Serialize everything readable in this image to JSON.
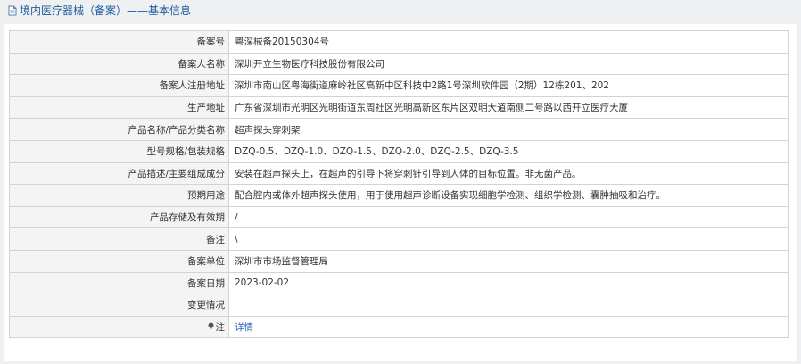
{
  "header": {
    "title": "境内医疗器械（备案）——基本信息"
  },
  "rows": [
    {
      "label": "备案号",
      "value": "粤深械备20150304号"
    },
    {
      "label": "备案人名称",
      "value": "深圳开立生物医疗科技股份有限公司"
    },
    {
      "label": "备案人注册地址",
      "value": "深圳市南山区粤海街道麻岭社区高新中区科技中2路1号深圳软件园（2期）12栋201、202"
    },
    {
      "label": "生产地址",
      "value": "广东省深圳市光明区光明街道东周社区光明高新区东片区双明大道南侧二号路以西开立医疗大厦"
    },
    {
      "label": "产品名称/产品分类名称",
      "value": "超声探头穿刺架"
    },
    {
      "label": "型号规格/包装规格",
      "value": "DZQ-0.5、DZQ-1.0、DZQ-1.5、DZQ-2.0、DZQ-2.5、DZQ-3.5"
    },
    {
      "label": "产品描述/主要组成成分",
      "value": "安装在超声探头上，在超声的引导下将穿刺针引导到人体的目标位置。非无菌产品。"
    },
    {
      "label": "预期用途",
      "value": "配合腔内或体外超声探头使用，用于使用超声诊断设备实现细胞学检测、组织学检测、囊肿抽吸和治疗。"
    },
    {
      "label": "产品存储及有效期",
      "value": "/"
    },
    {
      "label": "备注",
      "value": "\\"
    },
    {
      "label": "备案单位",
      "value": "深圳市市场监督管理局"
    },
    {
      "label": "备案日期",
      "value": "2023-02-02"
    },
    {
      "label": "变更情况",
      "value": ""
    }
  ],
  "note": {
    "label": "注",
    "icon": "pin-icon",
    "link_text": "详情"
  }
}
